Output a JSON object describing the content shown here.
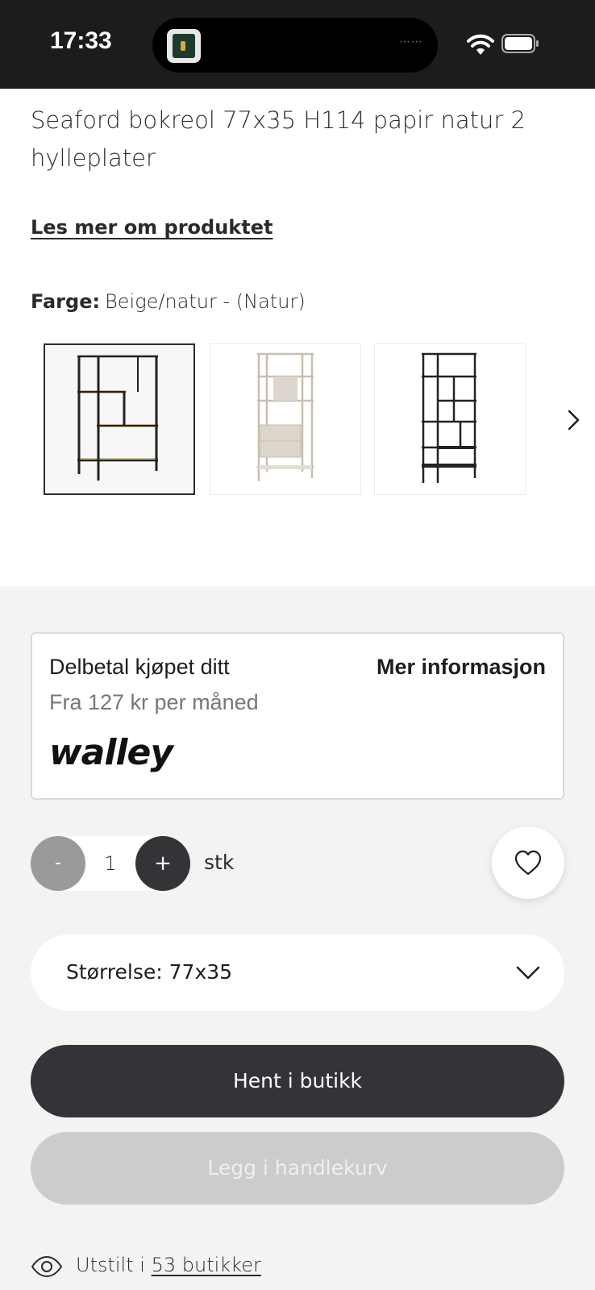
{
  "status_bar": {
    "time": "17:33",
    "island_dots": "⋯⋯"
  },
  "product": {
    "title": "Seaford bokreol 77x35 H114 papir natur 2 hylleplater",
    "read_more": "Les mer om produktet",
    "color_label": "Farge:",
    "color_value": "Beige/natur - (Natur)"
  },
  "swatches": [
    {
      "variant": "black-frame-natural-shelves",
      "selected": true
    },
    {
      "variant": "beige-frame-with-drawers",
      "selected": false
    },
    {
      "variant": "black-frame-black-shelves",
      "selected": false
    }
  ],
  "financing": {
    "title": "Delbetal kjøpet ditt",
    "more_info": "Mer informasjon",
    "subtitle": "Fra 127 kr per måned",
    "provider_logo": "walley"
  },
  "quantity": {
    "minus": "-",
    "value": "1",
    "plus": "+",
    "unit": "stk"
  },
  "size": {
    "label": "Størrelse: 77x35"
  },
  "actions": {
    "pickup_label": "Hent i butikk",
    "cart_label": "Legg i handlekurv"
  },
  "exhibited": {
    "prefix": "Utstilt i",
    "link": "53 butikker"
  },
  "colors": {
    "dark": "#333338",
    "disabled": "#cdcbcb",
    "page_bg": "#f4f3f1"
  }
}
